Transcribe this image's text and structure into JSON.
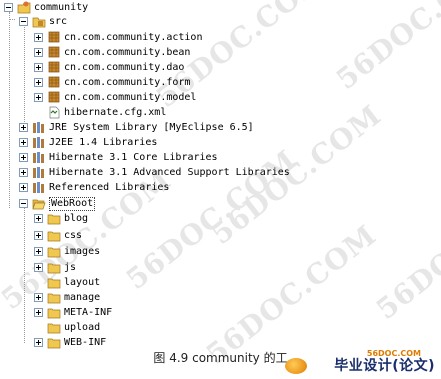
{
  "tree": [
    {
      "label": "community",
      "icon": "project-icon",
      "expanded": true
    },
    {
      "label": "src",
      "icon": "source-folder-icon",
      "expanded": true
    },
    {
      "label": "cn.com.community.action",
      "icon": "package-icon",
      "expanded": false
    },
    {
      "label": "cn.com.community.bean",
      "icon": "package-icon",
      "expanded": false
    },
    {
      "label": "cn.com.community.dao",
      "icon": "package-icon",
      "expanded": false
    },
    {
      "label": "cn.com.community.form",
      "icon": "package-icon",
      "expanded": false
    },
    {
      "label": "cn.com.community.model",
      "icon": "package-icon",
      "expanded": false
    },
    {
      "label": "hibernate.cfg.xml",
      "icon": "xml-file-icon"
    },
    {
      "label": "JRE System Library [MyEclipse 6.5]",
      "icon": "library-icon",
      "expanded": false
    },
    {
      "label": "J2EE 1.4 Libraries",
      "icon": "library-icon",
      "expanded": false
    },
    {
      "label": "Hibernate 3.1 Core Libraries",
      "icon": "library-icon",
      "expanded": false
    },
    {
      "label": "Hibernate 3.1 Advanced Support Libraries",
      "icon": "library-icon",
      "expanded": false
    },
    {
      "label": "Referenced Libraries",
      "icon": "library-icon",
      "expanded": false
    },
    {
      "label": "WebRoot",
      "icon": "folder-open-icon",
      "expanded": true
    },
    {
      "label": "blog",
      "icon": "folder-icon",
      "expanded": false
    },
    {
      "label": "css",
      "icon": "folder-icon",
      "expanded": false
    },
    {
      "label": "images",
      "icon": "folder-icon",
      "expanded": false
    },
    {
      "label": "js",
      "icon": "folder-icon",
      "expanded": false
    },
    {
      "label": "layout",
      "icon": "folder-icon"
    },
    {
      "label": "manage",
      "icon": "folder-icon",
      "expanded": false
    },
    {
      "label": "META-INF",
      "icon": "folder-icon",
      "expanded": false
    },
    {
      "label": "upload",
      "icon": "folder-icon"
    },
    {
      "label": "WEB-INF",
      "icon": "folder-icon",
      "expanded": false
    }
  ],
  "watermark": "56DOC.COM",
  "caption": "图 4.9 community 的工",
  "logo": {
    "url": "56DOC.COM",
    "text": "毕业设计(论文)"
  },
  "colors": {
    "package": "#c8862a",
    "folder": "#f0c850",
    "library": "#b07a3a",
    "xml": "#2a7a2a"
  }
}
